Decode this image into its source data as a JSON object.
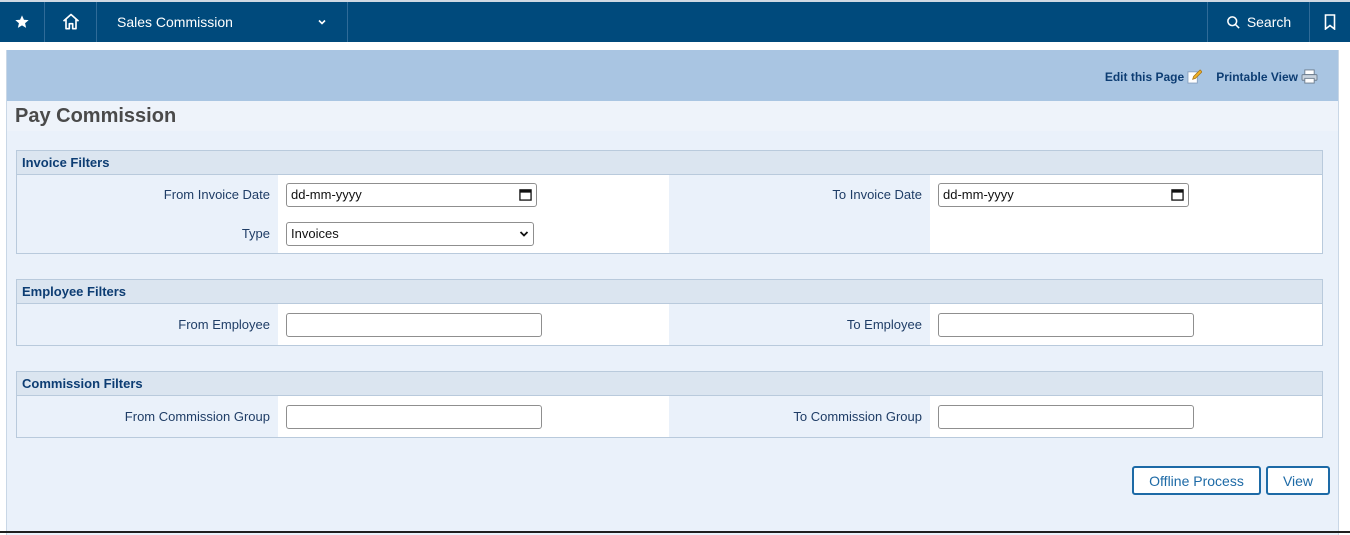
{
  "topbar": {
    "module_label": "Sales Commission",
    "search_label": "Search"
  },
  "page": {
    "edit_label": "Edit this Page",
    "print_label": "Printable View",
    "title": "Pay Commission"
  },
  "invoice_filters": {
    "title": "Invoice Filters",
    "from_label": "From Invoice Date",
    "from_value": "dd-mm-yyyy",
    "to_label": "To Invoice Date",
    "to_value": "dd-mm-yyyy",
    "type_label": "Type",
    "type_value": "Invoices"
  },
  "employee_filters": {
    "title": "Employee Filters",
    "from_label": "From Employee",
    "from_value": "",
    "to_label": "To Employee",
    "to_value": ""
  },
  "commission_filters": {
    "title": "Commission Filters",
    "from_label": "From Commission Group",
    "from_value": "",
    "to_label": "To Commission Group",
    "to_value": ""
  },
  "actions": {
    "offline_label": "Offline Process",
    "view_label": "View"
  },
  "icons": {
    "favorites": "star-icon",
    "home": "home-icon",
    "dropdown": "chevron-down-icon",
    "search": "search-icon",
    "bookmark": "bookmark-icon",
    "edit": "edit-page-icon",
    "print": "printer-icon",
    "calendar": "calendar-icon"
  }
}
